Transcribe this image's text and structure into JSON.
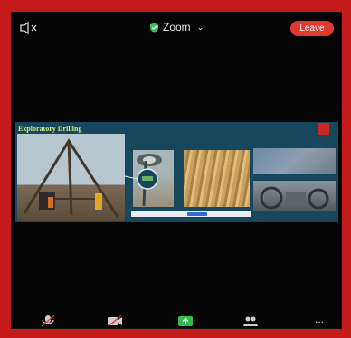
{
  "topbar": {
    "app_title": "Zoom",
    "leave_label": "Leave",
    "icons": {
      "speaker": "speaker-muted-icon",
      "shield": "shield-check-icon",
      "chevron": "chevron-down-icon"
    }
  },
  "shared_screen": {
    "slide_title": "Exploratory Drilling",
    "colors": {
      "background": "#17475c",
      "title": "#d8ea7a",
      "frame": "#c41a1a",
      "leave": "#e0392f"
    }
  },
  "bottom_toolbar": {
    "icons": [
      "microphone-icon",
      "video-icon",
      "share-icon",
      "participants-icon",
      "more-icon"
    ],
    "more_label": "..."
  }
}
